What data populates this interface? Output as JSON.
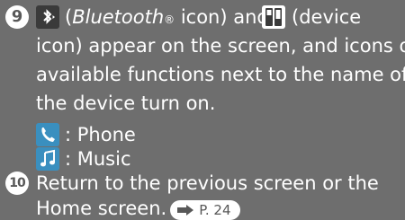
{
  "steps": [
    {
      "number": "9",
      "lines": [
        {
          "segments": [
            "(",
            "Bluetooth",
            "®",
            " icon) and ",
            "(device"
          ]
        },
        "icon) appear on the screen, and icons of",
        "available functions next to the name of",
        "the device turn on."
      ],
      "functions": [
        {
          "icon": "phone-icon",
          "label": ": Phone"
        },
        {
          "icon": "music-icon",
          "label": ": Music"
        }
      ]
    },
    {
      "number": "10",
      "lines": [
        "Return to the previous screen or the",
        "Home screen."
      ],
      "reference": "P. 24"
    }
  ],
  "icons": {
    "bluetooth": "bluetooth-icon",
    "device": "device-icon"
  },
  "colors": {
    "background": "#6e6e6e",
    "text": "#ffffff",
    "accent_icon": "#3a8fbf"
  }
}
